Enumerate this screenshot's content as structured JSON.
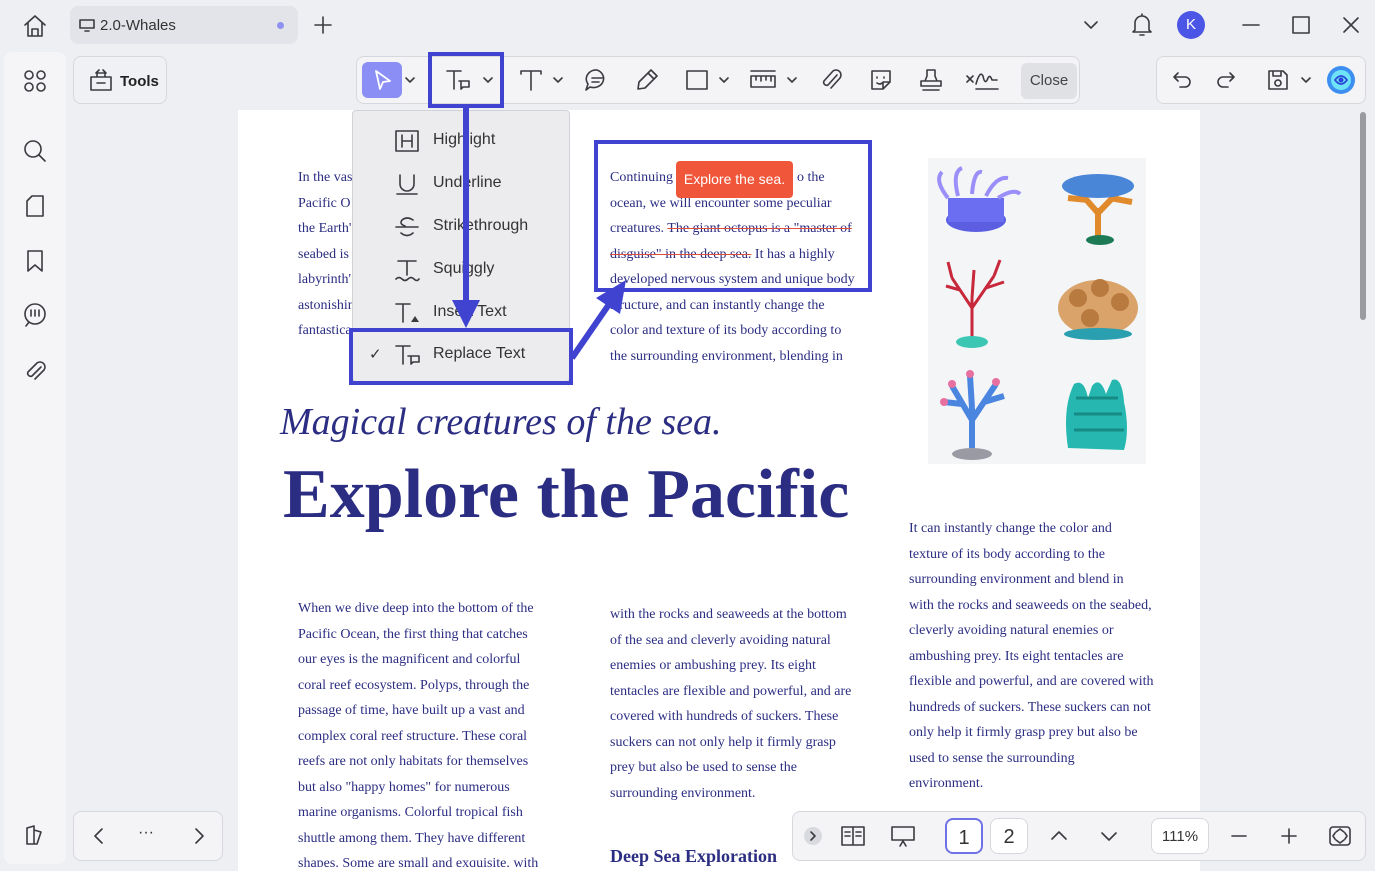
{
  "tab": {
    "title": "2.0-Whales"
  },
  "user": {
    "initial": "K"
  },
  "tools": {
    "label": "Tools"
  },
  "toolbar": {
    "close_label": "Close"
  },
  "menu": {
    "items": [
      {
        "label": "Highlight",
        "icon": "highlight-icon"
      },
      {
        "label": "Underline",
        "icon": "underline-icon"
      },
      {
        "label": "Strikethrough",
        "icon": "strikethrough-icon"
      },
      {
        "label": "Squiggly",
        "icon": "squiggly-icon"
      },
      {
        "label": "Insert Text",
        "icon": "insert-text-icon"
      },
      {
        "label": "Replace Text",
        "icon": "replace-text-icon",
        "checked": true
      }
    ]
  },
  "tooltip": {
    "text": "Explore the sea."
  },
  "doc": {
    "col1_top": [
      "In the vas",
      "Pacific O",
      "the Earth'",
      "seabed is",
      "labyrinth'",
      "astonishin",
      "fantastica"
    ],
    "col2_top": {
      "line1_a": "Continuing",
      "line1_b": "o the",
      "line2": "ocean, we will encounter some peculiar",
      "line3_a": "creatures.",
      "line3_strike": "The giant octopus is a \"master of",
      "line4_strike": "disguise\" in the deep sea.",
      "line4_b": "It has a highly",
      "line5": "developed nervous system and unique body",
      "line6": "structure, and can instantly change the",
      "line7": "color and texture of its body according to",
      "line8": "the surrounding environment, blending in"
    },
    "subheading": "Magical creatures of the sea.",
    "heading": "Explore the Pacific",
    "col1_bottom": [
      "When we dive deep into the bottom of the",
      "Pacific Ocean, the first thing that catches",
      "our eyes is the magnificent and colorful",
      "coral reef ecosystem. Polyps, through the",
      "passage of time, have built up a vast and",
      "complex coral reef structure. These coral",
      "reefs are not only habitats for themselves",
      "but also \"happy homes\" for numerous",
      "marine organisms. Colorful tropical fish",
      "shuttle among them. They have different",
      "shapes. Some are small and exquisite, with"
    ],
    "col2_bottom": [
      "with the rocks and seaweeds at the bottom",
      "of the sea and cleverly avoiding natural",
      "enemies or ambushing prey. Its eight",
      "tentacles are flexible and powerful, and are",
      "covered with hundreds of suckers. These",
      "suckers can not only help it firmly grasp",
      "prey but also be used to sense the",
      "surrounding environment."
    ],
    "col3": [
      "It can instantly change the color and",
      "texture of its body according to the",
      "surrounding environment and blend in",
      "with the rocks and seaweeds on the seabed,",
      "cleverly avoiding natural enemies or",
      "ambushing prey. Its eight tentacles are",
      "flexible and powerful, and are covered with",
      "hundreds of suckers. These suckers can not",
      "only help it firmly grasp prey but also be",
      "used to sense the surrounding",
      "environment."
    ],
    "deep_sea_heading": "Deep Sea Exploration"
  },
  "pager": {
    "page1": "1",
    "page2": "2",
    "zoom": "111%",
    "nav_more": "···"
  },
  "colors": {
    "accent": "#3f43d0",
    "select_bg": "#8b8ff5",
    "tooltip": "#f0573a",
    "doc_text": "#2b2d82"
  }
}
